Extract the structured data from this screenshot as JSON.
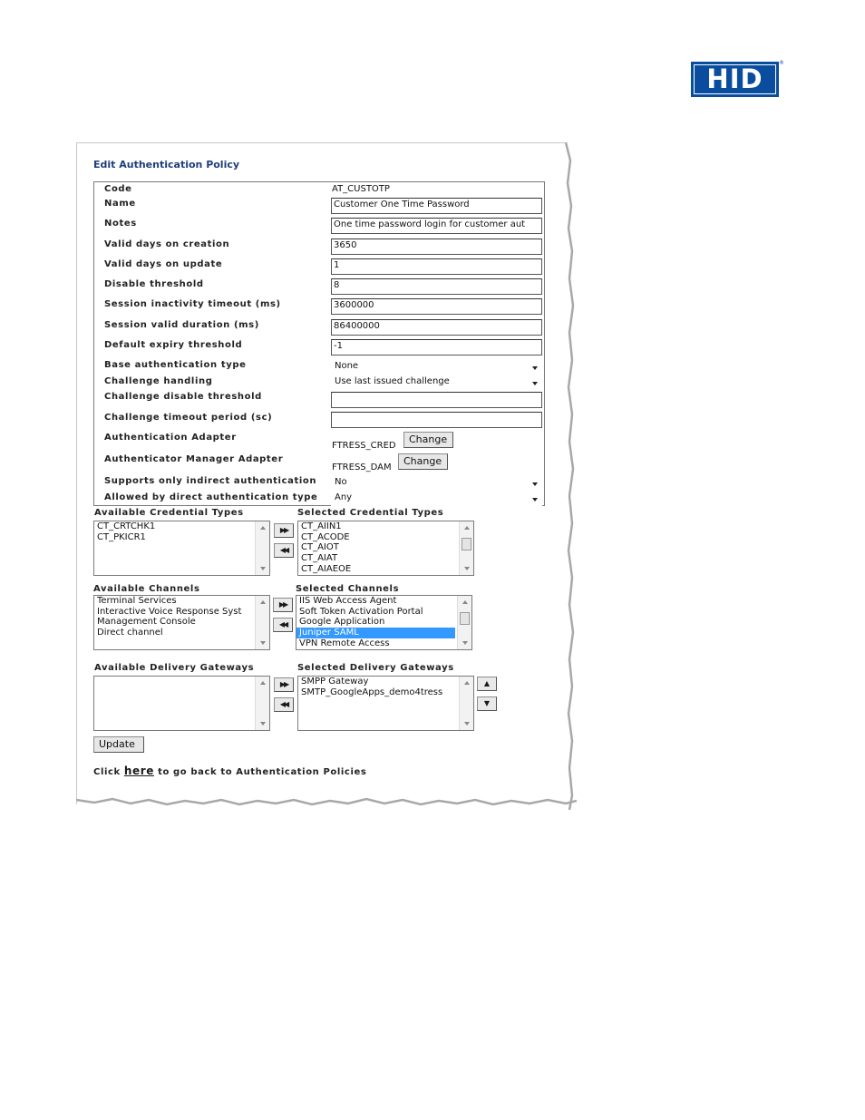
{
  "logo": {
    "text": "HID",
    "reg": "®"
  },
  "page_title": "Edit Authentication Policy",
  "form": {
    "code": {
      "label": "Code",
      "value": "AT_CUSTOTP"
    },
    "name": {
      "label": "Name",
      "value": "Customer One Time Password"
    },
    "notes": {
      "label": "Notes",
      "value": "One time password login for customer aut"
    },
    "valid_days_creation": {
      "label": "Valid days on creation",
      "value": "3650"
    },
    "valid_days_update": {
      "label": "Valid days on update",
      "value": "1"
    },
    "disable_threshold": {
      "label": "Disable threshold",
      "value": "8"
    },
    "session_inactivity": {
      "label": "Session inactivity timeout (ms)",
      "value": "3600000"
    },
    "session_valid": {
      "label": "Session valid duration (ms)",
      "value": "86400000"
    },
    "default_expiry": {
      "label": "Default expiry threshold",
      "value": "-1"
    },
    "base_auth_type": {
      "label": "Base authentication type",
      "value": "None"
    },
    "challenge_handling": {
      "label": "Challenge handling",
      "value": "Use last issued challenge"
    },
    "challenge_disable": {
      "label": "Challenge disable threshold",
      "value": ""
    },
    "challenge_timeout": {
      "label": "Challenge timeout period (sc)",
      "value": ""
    },
    "auth_adapter": {
      "label": "Authentication Adapter",
      "value": "FTRESS_CRED",
      "button": "Change"
    },
    "auth_mgr_adapter": {
      "label": "Authenticator Manager Adapter",
      "value": "FTRESS_DAM",
      "button": "Change"
    },
    "indirect_only": {
      "label": "Supports only indirect authentication",
      "value": "No"
    },
    "direct_type": {
      "label": "Allowed by direct authentication type",
      "value": "Any"
    }
  },
  "credential_types": {
    "available_label": "Available Credential Types",
    "selected_label": "Selected Credential Types",
    "available": [
      "CT_CRTCHK1",
      "CT_PKICR1"
    ],
    "selected": [
      "CT_AIIN1",
      "CT_ACODE",
      "CT_AIOT",
      "CT_AIAT",
      "CT_AIAEOE"
    ]
  },
  "channels": {
    "available_label": "Available Channels",
    "selected_label": "Selected Channels",
    "available": [
      "Terminal Services",
      "Interactive Voice Response Syst",
      "Management Console",
      "Direct channel"
    ],
    "selected": [
      "IIS Web Access Agent",
      "Soft Token Activation Portal",
      "Google Application",
      "Juniper SAML",
      "VPN Remote Access"
    ],
    "selected_highlight_index": 3
  },
  "gateways": {
    "available_label": "Available Delivery Gateways",
    "selected_label": "Selected Delivery Gateways",
    "available": [],
    "selected": [
      "SMPP Gateway",
      "SMTP_GoogleApps_demo4tress"
    ]
  },
  "update_button": "Update",
  "back_link": {
    "prefix": "Click",
    "link": "here",
    "suffix": "to go back to Authentication Policies"
  }
}
